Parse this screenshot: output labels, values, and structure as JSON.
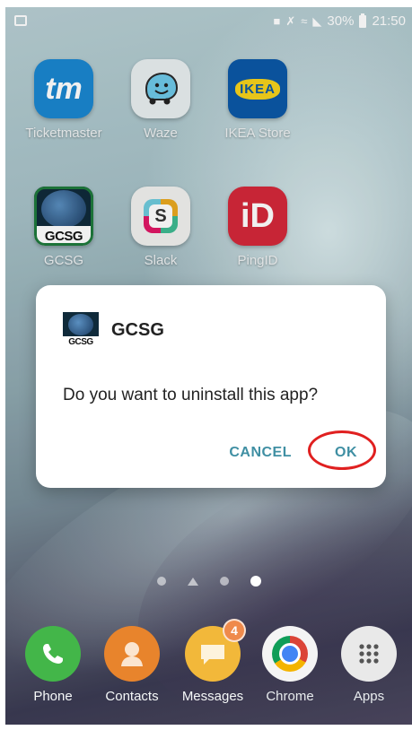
{
  "status_bar": {
    "battery_percent": "30%",
    "time": "21:50"
  },
  "home_apps": [
    {
      "name": "Ticketmaster",
      "icon": "ticketmaster-icon",
      "glyph": "tm",
      "color": "#1a86d0"
    },
    {
      "name": "Waze",
      "icon": "waze-icon",
      "color": "#6ec8e8"
    },
    {
      "name": "IKEA Store",
      "icon": "ikea-icon",
      "glyph": "IKEA",
      "color": "#0b58a6"
    },
    {
      "name": "GCSG",
      "icon": "gcsg-icon",
      "glyph": "GCSG",
      "color": "#1e7a3c"
    },
    {
      "name": "Slack",
      "icon": "slack-icon",
      "glyph": "S",
      "color": "#f0f0f0"
    },
    {
      "name": "PingID",
      "icon": "pingid-icon",
      "glyph": "iD",
      "color": "#d4283a"
    }
  ],
  "dialog": {
    "app_name": "GCSG",
    "app_icon_glyph": "GCSG",
    "message": "Do you want to uninstall this app?",
    "cancel_label": "CANCEL",
    "ok_label": "OK",
    "accent_color": "#3f8fa3",
    "highlight_color": "#e02020"
  },
  "page_indicator": {
    "pages": 4,
    "active_page": 4
  },
  "dock": [
    {
      "name": "Phone",
      "icon": "phone-icon",
      "color": "#43b649"
    },
    {
      "name": "Contacts",
      "icon": "contacts-icon",
      "color": "#e8842c"
    },
    {
      "name": "Messages",
      "icon": "messages-icon",
      "color": "#f2b83a",
      "badge": "4"
    },
    {
      "name": "Chrome",
      "icon": "chrome-icon",
      "color": "#ffffff"
    },
    {
      "name": "Apps",
      "icon": "apps-grid-icon",
      "color": "#e9e9e9"
    }
  ]
}
